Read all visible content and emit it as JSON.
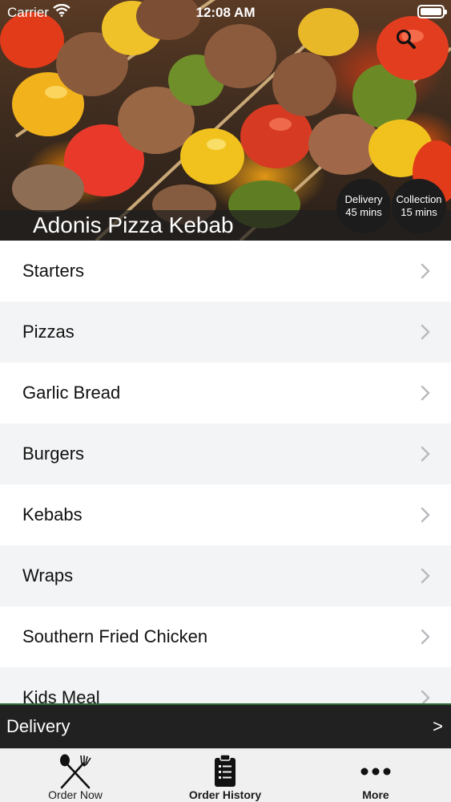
{
  "status_bar": {
    "carrier": "Carrier",
    "time": "12:08 AM"
  },
  "header": {
    "restaurant_name": "Adonis Pizza Kebab",
    "delivery_badge": {
      "label": "Delivery",
      "time": "45 mins"
    },
    "collection_badge": {
      "label": "Collection",
      "time": "15 mins"
    },
    "search_icon": "search-icon"
  },
  "menu": {
    "categories": [
      {
        "label": "Starters"
      },
      {
        "label": "Pizzas"
      },
      {
        "label": "Garlic Bread"
      },
      {
        "label": "Burgers"
      },
      {
        "label": "Kebabs"
      },
      {
        "label": "Wraps"
      },
      {
        "label": "Southern Fried Chicken"
      },
      {
        "label": "Kids Meal"
      }
    ]
  },
  "delivery_bar": {
    "label": "Delivery",
    "arrow": ">"
  },
  "tab_bar": {
    "items": [
      {
        "label": "Order Now",
        "icon": "fork-knife-icon"
      },
      {
        "label": "Order History",
        "icon": "clipboard-icon"
      },
      {
        "label": "More",
        "icon": "more-dots-icon"
      }
    ]
  },
  "colors": {
    "delivery_bar_bg": "#212121",
    "delivery_bar_accent": "#2f6a3a",
    "alt_row_bg": "#f2f4f5",
    "badge_bg": "#1c1c1c"
  }
}
